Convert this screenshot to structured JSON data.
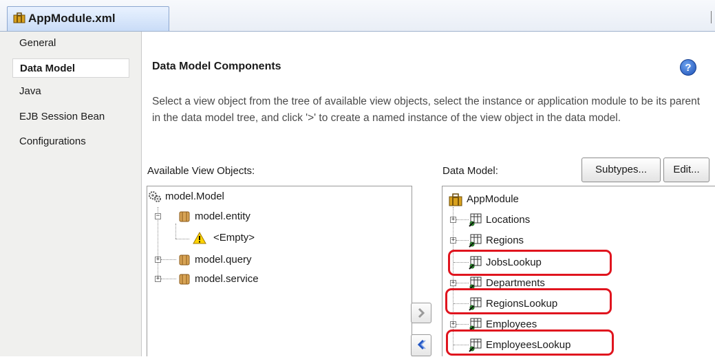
{
  "editor_tab": {
    "title": "AppModule.xml",
    "icon": "suitcase-icon"
  },
  "sidebar": {
    "items": [
      {
        "label": "General",
        "selected": false
      },
      {
        "label": "Data Model",
        "selected": true
      },
      {
        "label": "Java",
        "selected": false
      },
      {
        "label": "EJB Session Bean",
        "selected": false
      },
      {
        "label": "Configurations",
        "selected": false
      }
    ]
  },
  "main": {
    "title": "Data Model Components",
    "help_icon": "help-icon",
    "description": "Select a view object from the tree of available view objects, select the instance or application module to be its parent in the data model tree, and click '>' to create a named instance of the view object in the data model.",
    "available_label": "Available View Objects:",
    "datamodel_label": "Data Model:",
    "subtypes_label": "Subtypes...",
    "edit_label": "Edit...",
    "add_button_glyph": ">",
    "remove_button_glyph": "<"
  },
  "available_tree": {
    "root": "model.Model",
    "entity": "model.entity",
    "empty": "<Empty>",
    "query": "model.query",
    "service": "model.service"
  },
  "datamodel_tree": {
    "root": "AppModule",
    "items": [
      "Locations",
      "Regions",
      "JobsLookup",
      "Departments",
      "RegionsLookup",
      "Employees",
      "EmployeesLookup"
    ]
  },
  "colors": {
    "highlight": "#e0141e",
    "accent": "#1b4fb5"
  }
}
